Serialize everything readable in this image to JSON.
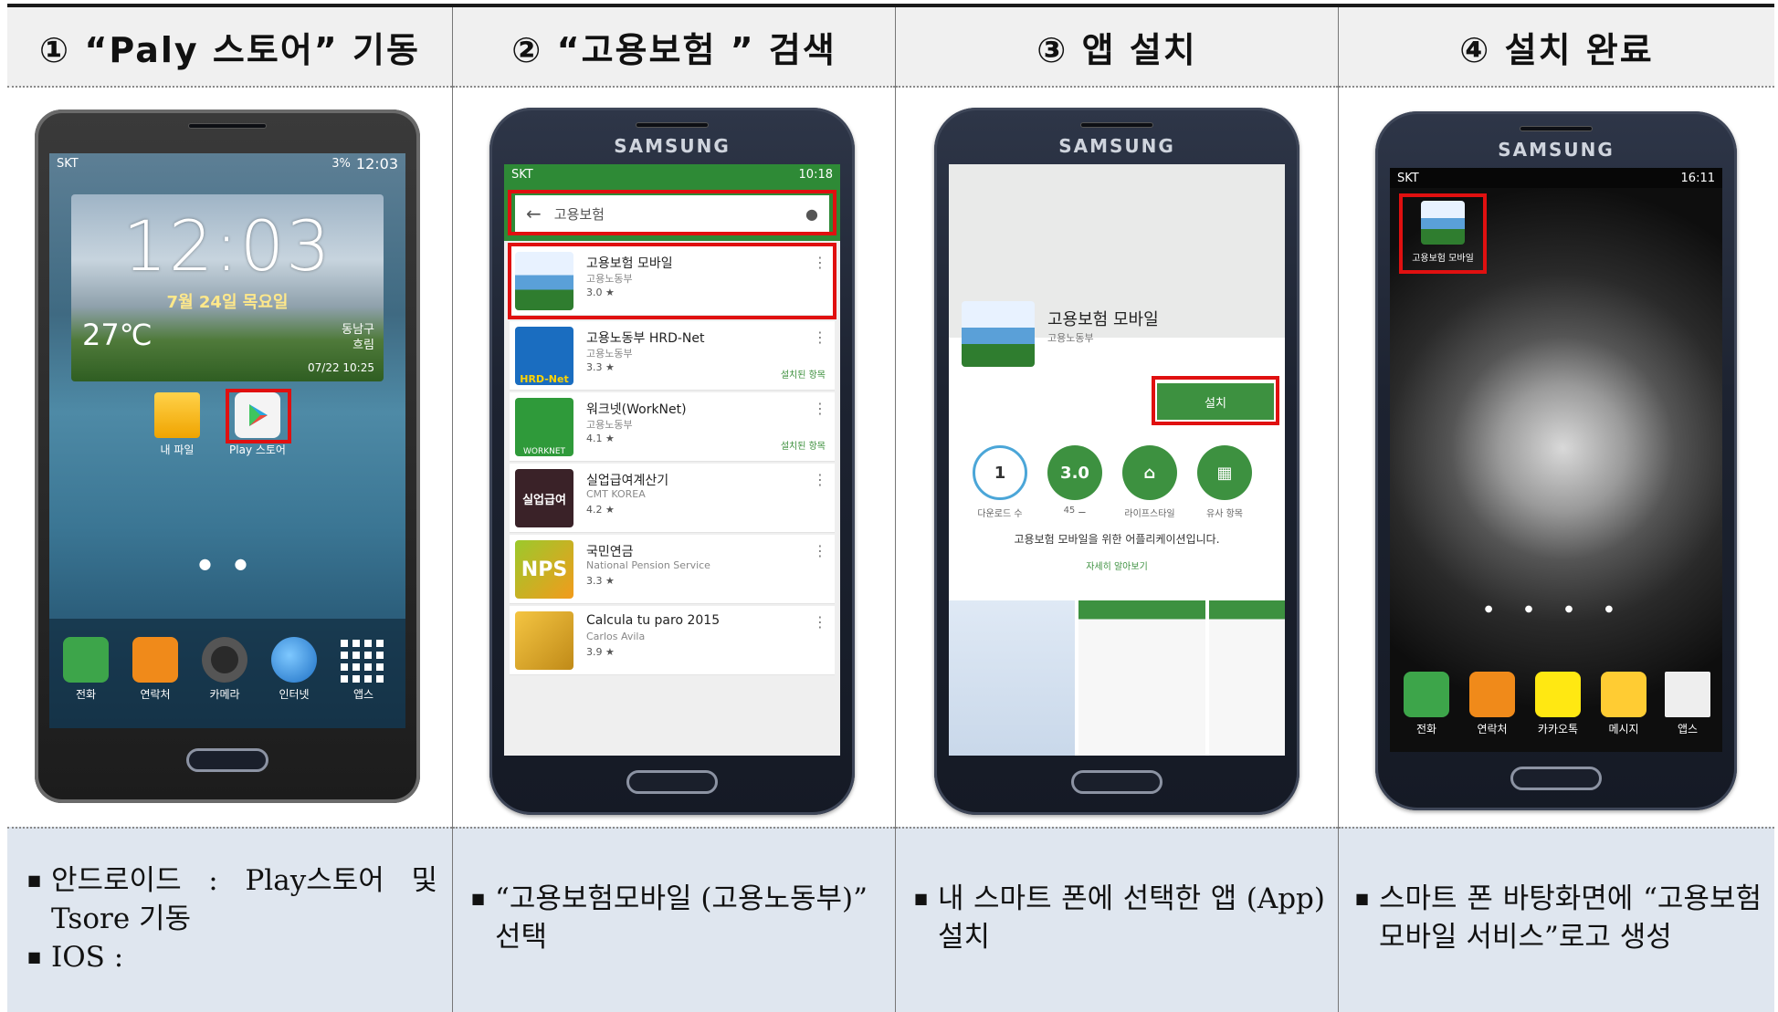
{
  "headers": [
    "① “Paly 스토어” 기동",
    "② “고용보험 ” 검색",
    "③ 앱 설치",
    "④ 설치 완료"
  ],
  "descriptions": {
    "col1": [
      "안드로이드 : Play스토어 및 Tsore 기동",
      "IOS :"
    ],
    "col2": [
      "“고용보험모바일 (고용노동부)” 선택"
    ],
    "col3": [
      "내 스마트 폰에 선택한 앱 (App) 설치"
    ],
    "col4": [
      "스마트 폰 바탕화면에 “고용보험 모바일 서비스”로고 생성"
    ]
  },
  "brand": "SAMSUNG",
  "phone1": {
    "carrier": "SKT",
    "status_time": "12:03",
    "battery": "3%",
    "clock": "12:03",
    "date": "7월 24일 목요일",
    "temperature": "27℃",
    "location": "동남구",
    "weather": "흐림",
    "updated": "07/22 10:25",
    "icons": [
      {
        "label": "내 파일"
      },
      {
        "label": "Play 스토어"
      }
    ],
    "dock": [
      {
        "label": "전화",
        "icon": "phone-icon"
      },
      {
        "label": "연락처",
        "icon": "contacts-icon"
      },
      {
        "label": "카메라",
        "icon": "camera-icon"
      },
      {
        "label": "인터넷",
        "icon": "globe-icon"
      },
      {
        "label": "앱스",
        "icon": "apps-grid-icon"
      }
    ]
  },
  "phone2": {
    "carrier": "SKT",
    "status_time": "10:18",
    "search_query": "고용보험",
    "results": [
      {
        "name": "고용보험 모바일",
        "dev": "고용노동부",
        "rating": "3.0 ★",
        "installed": ""
      },
      {
        "name": "고용노동부 HRD-Net",
        "dev": "고용노동부",
        "rating": "3.3 ★",
        "installed": "설치된 항목"
      },
      {
        "name": "워크넷(WorkNet)",
        "dev": "고용노동부",
        "rating": "4.1 ★",
        "installed": "설치된 항목"
      },
      {
        "name": "실업급여계산기",
        "dev": "CMT KOREA",
        "rating": "4.2 ★",
        "installed": ""
      },
      {
        "name": "국민연금",
        "dev": "National Pension Service",
        "rating": "3.3 ★",
        "installed": ""
      },
      {
        "name": "Calcula tu paro 2015",
        "dev": "Carlos Avila",
        "rating": "3.9 ★",
        "installed": ""
      }
    ],
    "icon_text": {
      "hrd": "HRD-Net",
      "work": "WORKNET",
      "nps": "NPS",
      "calc": "실업급여"
    }
  },
  "phone3": {
    "app_name": "고용보험 모바일",
    "developer": "고용노동부",
    "install_label": "설치",
    "stats": [
      {
        "value": "1",
        "label": "다운로드 수",
        "color": "#ffffff"
      },
      {
        "value": "3.0",
        "label": "45 ⚊",
        "color": "#3d9140"
      },
      {
        "value": "⌂",
        "label": "라이프스타일",
        "color": "#3d9140"
      },
      {
        "value": "▦",
        "label": "유사 항목",
        "color": "#3d9140"
      }
    ],
    "description": "고용보험 모바일을 위한 어플리케이션입니다.",
    "more": "자세히 알아보기"
  },
  "phone4": {
    "carrier": "SKT",
    "status_time": "16:11",
    "desktop_icon_label": "고용보험 모바일",
    "dock": [
      {
        "label": "전화",
        "icon": "phone-icon"
      },
      {
        "label": "연락처",
        "icon": "contacts-icon"
      },
      {
        "label": "카카오톡",
        "icon": "kakaotalk-icon"
      },
      {
        "label": "메시지",
        "icon": "message-icon"
      },
      {
        "label": "앱스",
        "icon": "apps-grid-icon"
      }
    ]
  },
  "colors": {
    "header_bg": "#f0f0f0",
    "desc_bg": "#dfe6ef",
    "highlight_red": "#e01010",
    "play_green": "#2e8a36"
  }
}
